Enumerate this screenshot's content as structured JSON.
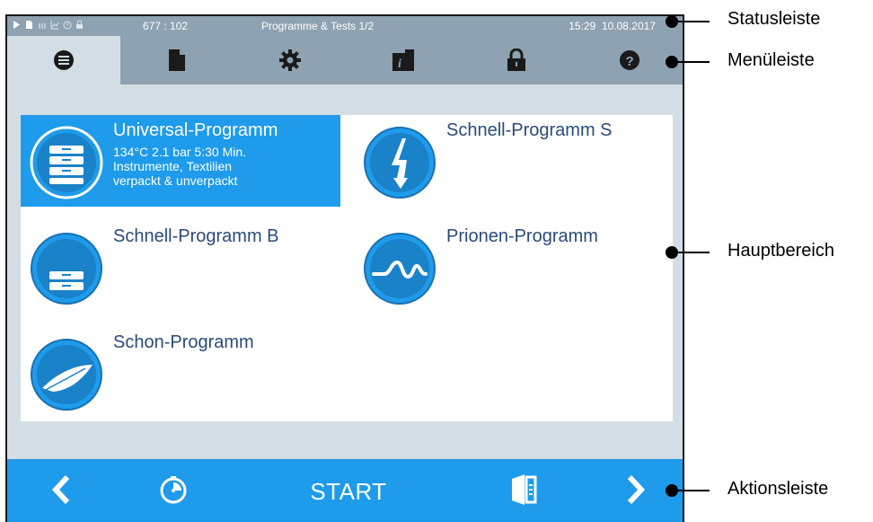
{
  "status_bar": {
    "counter": "677 : 102",
    "title": "Programme & Tests  1/2",
    "time": "15:29",
    "date": "10.08.2017",
    "icons": [
      "play-icon",
      "file-icon",
      "heat-icon",
      "chart-icon",
      "clock-icon",
      "lock-icon"
    ]
  },
  "menu_bar": {
    "tabs": [
      {
        "icon": "list-icon",
        "active": true
      },
      {
        "icon": "document-icon",
        "active": false
      },
      {
        "icon": "gear-icon",
        "active": false
      },
      {
        "icon": "info-folder-icon",
        "active": false
      },
      {
        "icon": "lock-icon",
        "active": false
      },
      {
        "icon": "help-icon",
        "active": false
      }
    ]
  },
  "programs": [
    {
      "title": "Universal-Programm",
      "line1": "134°C   2.1 bar   5:30 Min.",
      "line2": "Instrumente, Textilien",
      "line3": "verpackt & unverpackt",
      "selected": true,
      "icon": "stacked-trays-icon"
    },
    {
      "title": "Schnell-Programm S",
      "selected": false,
      "icon": "lightning-icon"
    },
    {
      "title": "Schnell-Programm B",
      "selected": false,
      "icon": "single-tray-icon"
    },
    {
      "title": "Prionen-Programm",
      "selected": false,
      "icon": "prion-wave-icon"
    },
    {
      "title": "Schon-Programm",
      "selected": false,
      "icon": "feather-icon"
    }
  ],
  "action_bar": {
    "back_icon": "chevron-left-icon",
    "timer_icon": "timer-icon",
    "start_label": "START",
    "door_icon": "door-icon",
    "forward_icon": "chevron-right-icon"
  },
  "callouts": {
    "status": "Statusleiste",
    "menu": "Menüleiste",
    "main": "Hauptbereich",
    "action": "Aktionsleiste"
  },
  "colors": {
    "bar_gray": "#8ea2b1",
    "background": "#d3dee4",
    "accent_blue": "#1e9bea",
    "program_title": "#2a4a7a"
  }
}
